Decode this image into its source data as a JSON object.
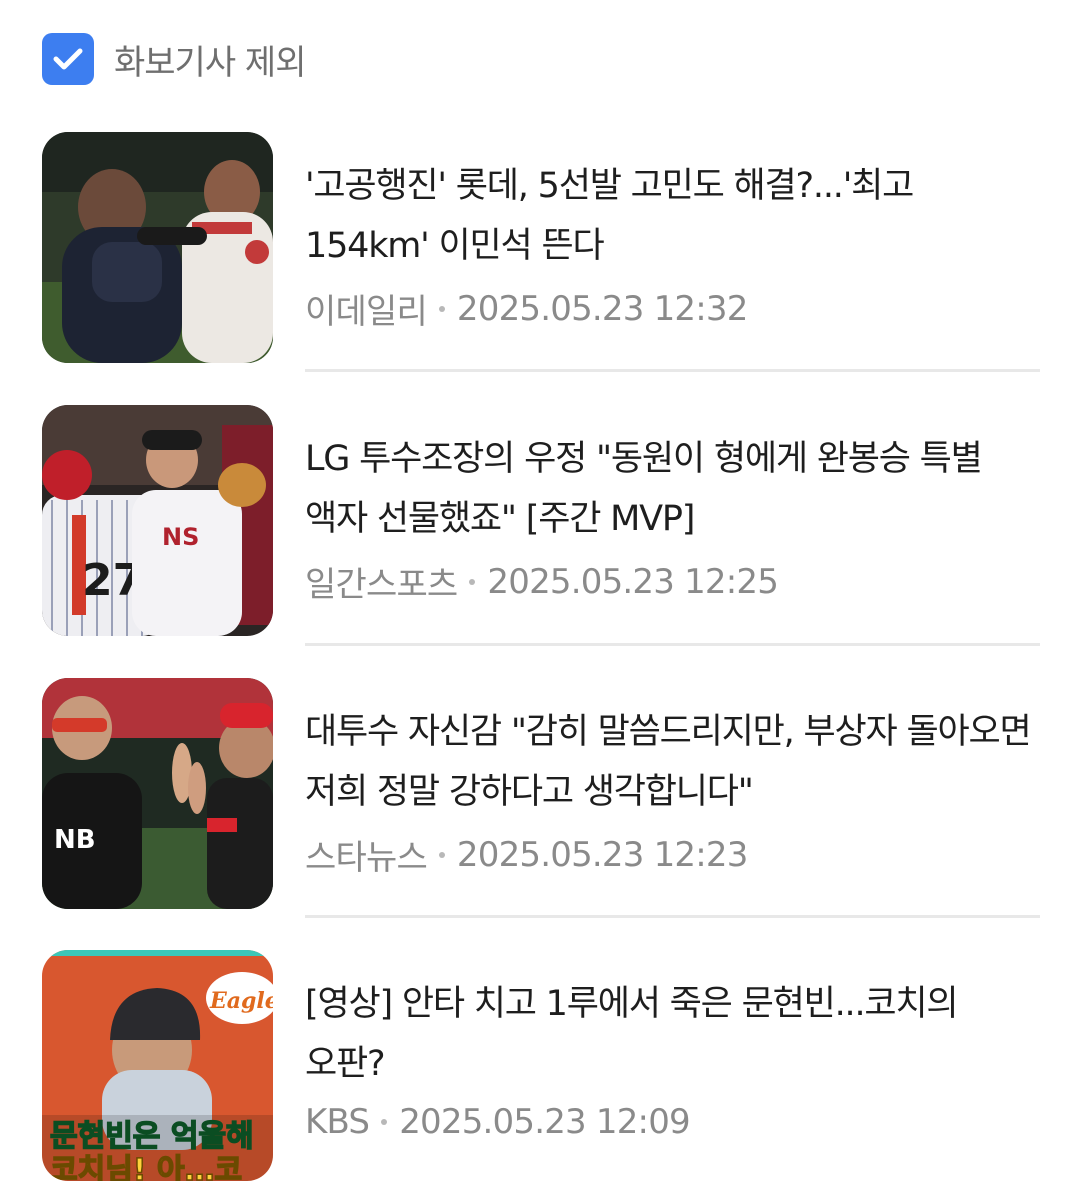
{
  "filter": {
    "label": "화보기사 제외",
    "checked": true,
    "check_color": "#3d7ef0",
    "icon": "check-icon"
  },
  "articles": [
    {
      "title": "'고공행진' 롯데, 5선발 고민도 해결?...'최고 154km' 이민석 뜬다",
      "source": "이데일리",
      "datetime": "2025.05.23 12:32",
      "thumbnail": "photo-players-celebrating"
    },
    {
      "title": "LG 투수조장의 우정 \"동원이 형에게 완봉승 특별 액자 선물했죠\" [주간 MVP]",
      "source": "일간스포츠",
      "datetime": "2025.05.23 12:25",
      "thumbnail": "photo-lg-pitcher"
    },
    {
      "title": "대투수 자신감 \"감히 말씀드리지만, 부상자 돌아오면 저희 정말 강하다고 생각합니다\"",
      "source": "스타뉴스",
      "datetime": "2025.05.23 12:23",
      "thumbnail": "photo-high-five"
    },
    {
      "title": "[영상] 안타 치고 1루에서 죽은 문현빈...코치의 오판?",
      "source": "KBS",
      "datetime": "2025.05.23 12:09",
      "thumbnail": "video-eagles",
      "thumbnail_text": {
        "logo": "Eagles",
        "line1": "문현빈은 억울해",
        "line2": "코치님! 아…코"
      }
    }
  ]
}
